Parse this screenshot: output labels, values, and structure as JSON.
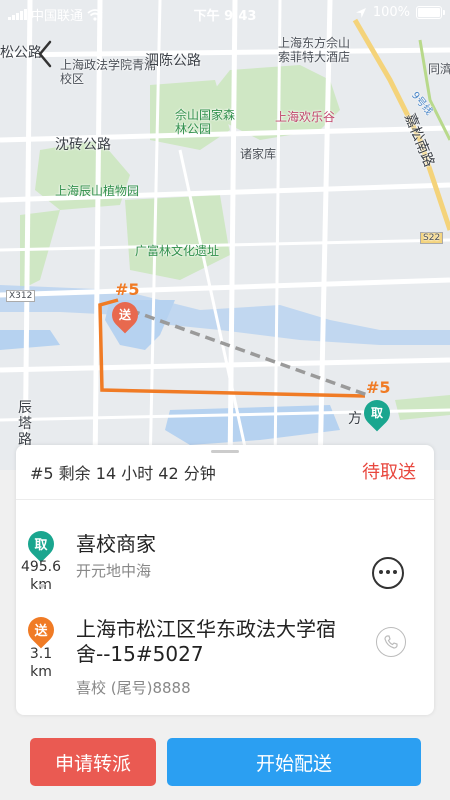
{
  "status_bar": {
    "carrier": "中国联通",
    "time": "下午 9:43",
    "battery": "100%",
    "icons": [
      "signal-icon",
      "wifi-icon",
      "location-arrow-icon",
      "battery-icon"
    ]
  },
  "map": {
    "labels": {
      "songgong_road": "松公路",
      "university_campus": "上海政法学院青浦校区",
      "sichen_road": "泗陈公路",
      "oriental_sheshan": "上海东方佘山",
      "sofitel": "索菲特大酒店",
      "tongji": "同濟",
      "sheshan_park": "佘山国家森林公园",
      "happy_valley": "上海欢乐谷",
      "shenzhuan_road": "沈砖公路",
      "zhujiaku": "诸家库",
      "chenshan_garden": "上海辰山植物园",
      "jiasong_south_road": "嘉松南路",
      "s22": "S22",
      "guangfulin": "广富林文化遗址",
      "x312": "X312",
      "chenta_road": "辰塔路",
      "fang": "方",
      "line9": "9号线"
    },
    "pin_drop_label": "送",
    "pin_pick_label": "取",
    "order_tag": "#5",
    "route_color": "#f07b25",
    "pick_color": "#1aa68f",
    "drop_color": "#e8694e"
  },
  "order": {
    "summary": "#5 剩余 14 小时 42 分钟",
    "status": "待取送"
  },
  "pickup": {
    "badge": "取",
    "distance_value": "495.6",
    "distance_unit": "km",
    "name": "喜校商家",
    "sub": "开元地中海"
  },
  "dropoff": {
    "badge": "送",
    "distance_value": "3.1",
    "distance_unit": "km",
    "address": "上海市松江区华东政法大学宿舍--15#5027",
    "contact": "喜校  (尾号)8888"
  },
  "actions": {
    "transfer": "申请转派",
    "start": "开始配送"
  }
}
